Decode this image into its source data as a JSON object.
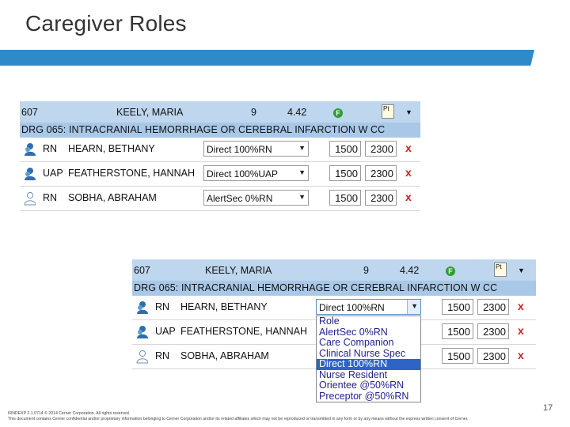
{
  "slide": {
    "title": "Caregiver Roles",
    "page_number": "17",
    "footer_line1": "IRNDEXP 2.1.0714   © 2014 Cerner Corporation. All rights reserved.",
    "footer_line2": "This document contains Cerner confidential and/or proprietary information belonging to Cerner Corporation and/or its related affiliates which may not be reproduced or transmitted in any form or by any means without the express written consent of Cerner."
  },
  "colors": {
    "accent_bar": "#2f8ac9",
    "header_bg": "#bed6ee",
    "drg_bg": "#a9c8e7",
    "remove_x": "#d21d1d",
    "selected_option": "#2f64c7"
  },
  "panel_1": {
    "header": {
      "room": "607",
      "patient": "KEELY, MARIA",
      "acuity": "9",
      "score": "4.42",
      "f_badge": "F",
      "pt_icon": "Pt"
    },
    "drg": "DRG 065: INTRACRANIAL HEMORRHAGE OR CEREBRAL INFARCTION W CC",
    "rows": [
      {
        "role": "RN",
        "name": "HEARN, BETHANY",
        "assignment": "Direct 100%RN",
        "start": "1500",
        "end": "2300",
        "remove": "x"
      },
      {
        "role": "UAP",
        "name": "FEATHERSTONE, HANNAH",
        "assignment": "Direct 100%UAP",
        "start": "1500",
        "end": "2300",
        "remove": "x"
      },
      {
        "role": "RN",
        "name": "SOBHA, ABRAHAM",
        "assignment": "AlertSec 0%RN",
        "start": "1500",
        "end": "2300",
        "remove": "x"
      }
    ]
  },
  "panel_2": {
    "header": {
      "room": "607",
      "patient": "KEELY, MARIA",
      "acuity": "9",
      "score": "4.42",
      "f_badge": "F",
      "pt_icon": "Pt"
    },
    "drg": "DRG 065: INTRACRANIAL HEMORRHAGE OR CEREBRAL INFARCTION W CC",
    "rows": [
      {
        "role": "RN",
        "name": "HEARN, BETHANY",
        "assignment": "Direct 100%RN",
        "start": "1500",
        "end": "2300",
        "remove": "x"
      },
      {
        "role": "UAP",
        "name": "FEATHERSTONE, HANNAH",
        "assignment": "",
        "start": "1500",
        "end": "2300",
        "remove": "x"
      },
      {
        "role": "RN",
        "name": "SOBHA, ABRAHAM",
        "assignment": "",
        "start": "1500",
        "end": "2300",
        "remove": "x"
      }
    ],
    "dropdown_options": [
      "Role",
      "AlertSec 0%RN",
      "Care Companion",
      "Clinical Nurse Spec",
      "Direct 100%RN",
      "Nurse Resident",
      "Orientee @50%RN",
      "Preceptor @50%RN"
    ],
    "dropdown_selected": "Direct 100%RN"
  }
}
